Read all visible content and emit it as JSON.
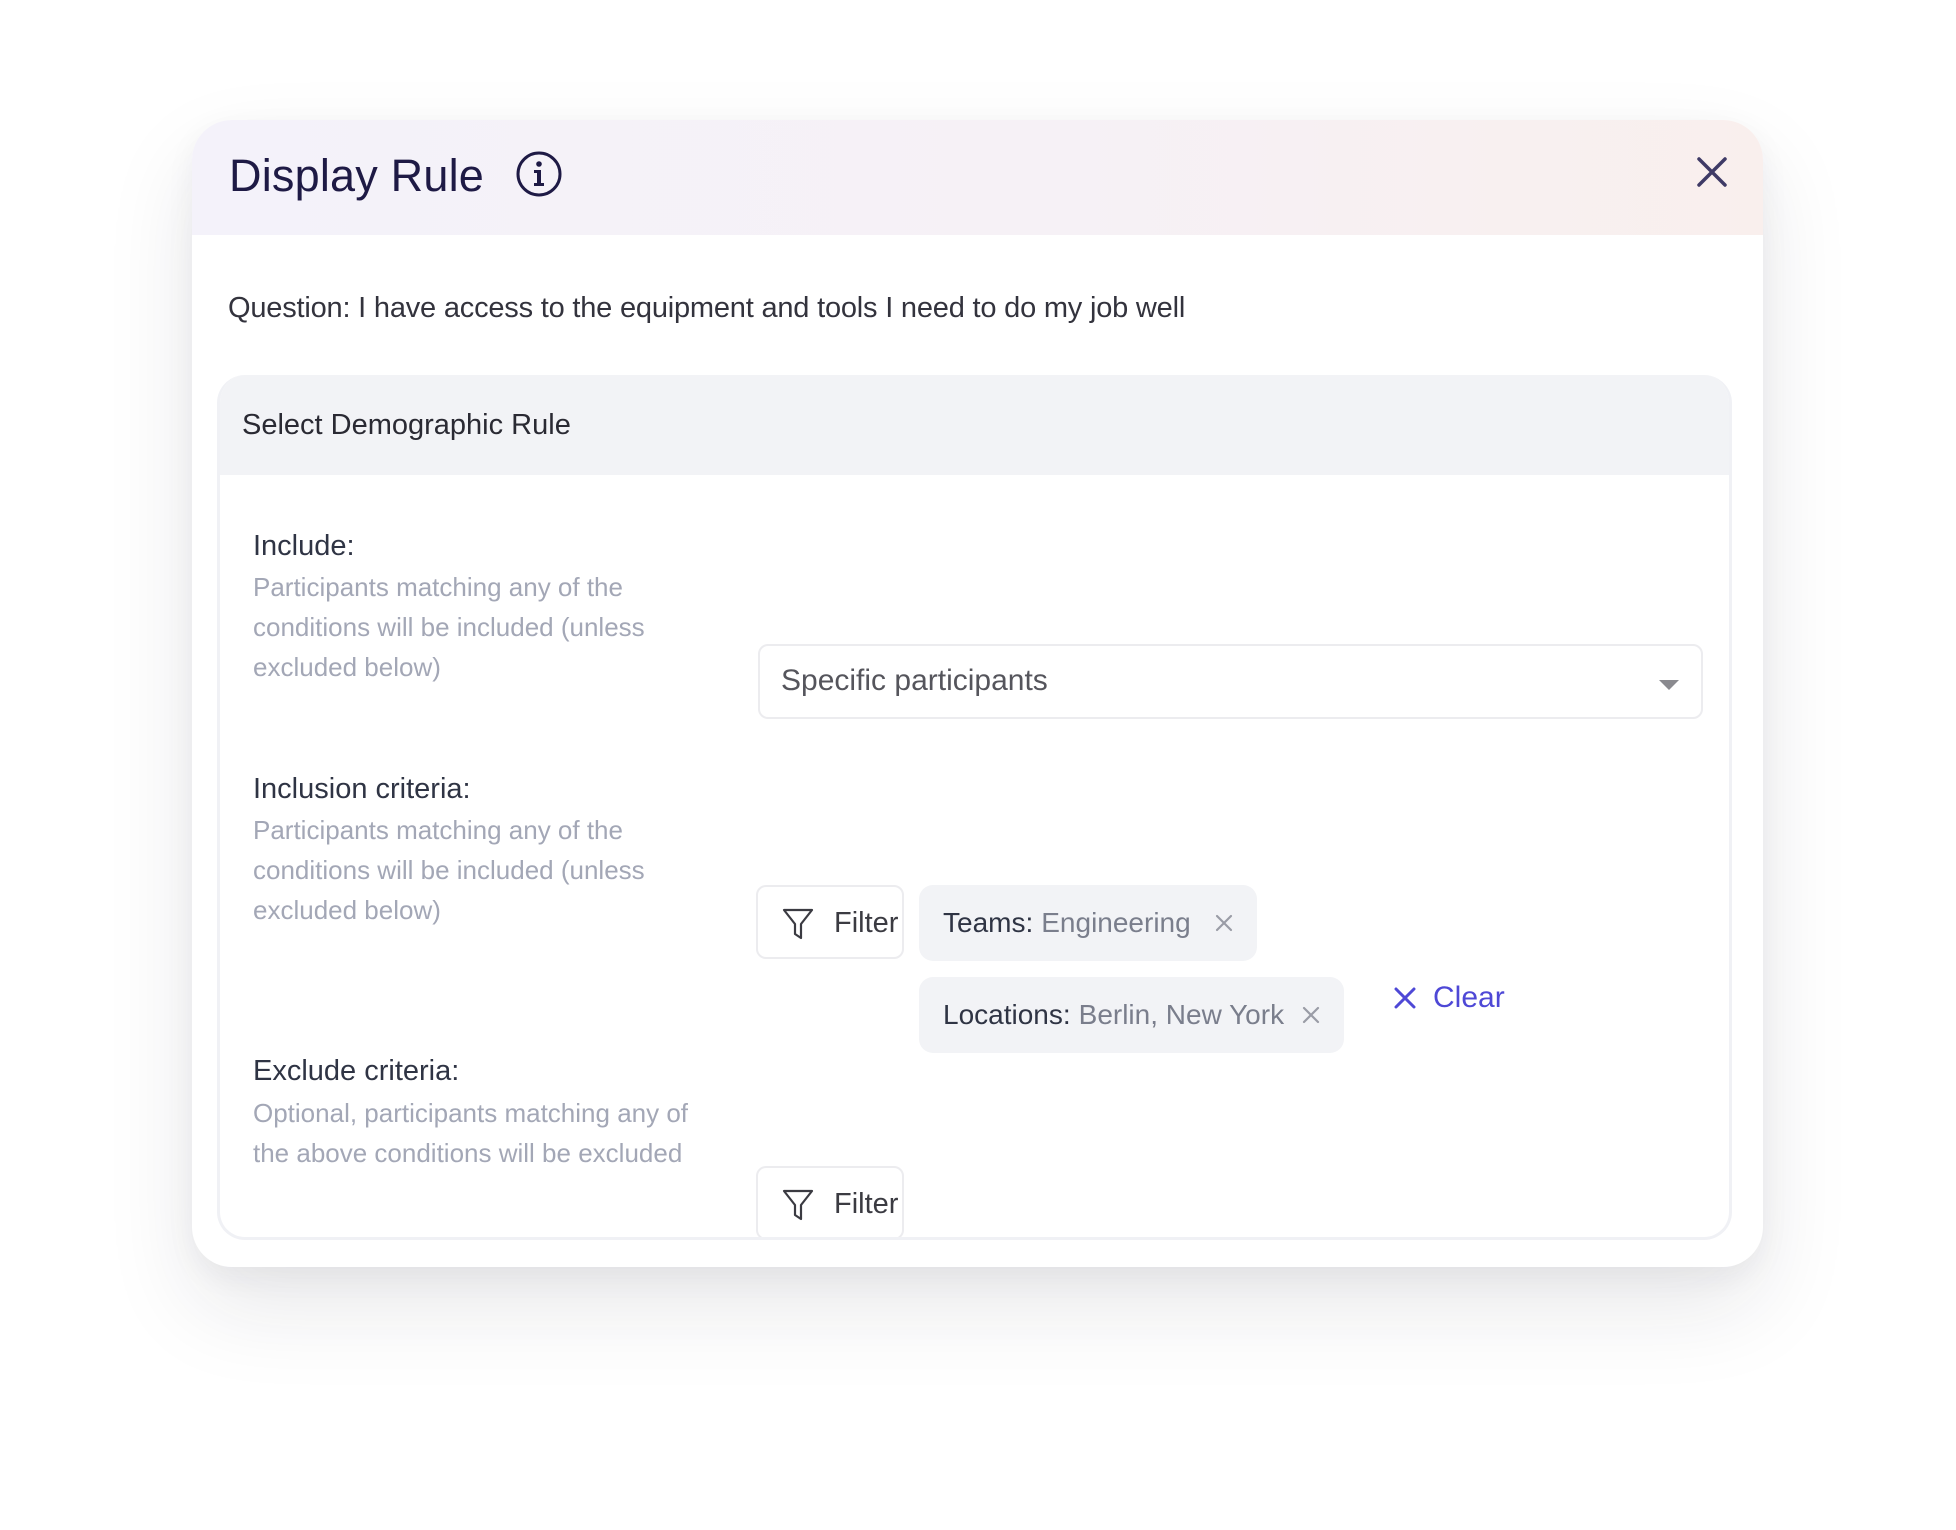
{
  "dialog": {
    "title": "Display Rule",
    "info_icon": "info-icon",
    "close_icon": "close-icon",
    "question": "Question: I have access to the equipment and tools I need to do my job well"
  },
  "panel": {
    "title": "Select Demographic Rule",
    "include": {
      "label": "Include:",
      "description": "Participants matching any of the conditions will be included (unless excluded below)",
      "select_value": "Specific participants"
    },
    "inclusion": {
      "label": "Inclusion criteria:",
      "description": "Participants matching any of the conditions will be included (unless excluded below)",
      "filter_label": "Filter",
      "chips": [
        {
          "key": "Teams:",
          "value": "Engineering"
        },
        {
          "key": "Locations:",
          "value": "Berlin, New York"
        }
      ],
      "clear_label": "Clear"
    },
    "exclude": {
      "label": "Exclude criteria:",
      "description": "Optional, participants matching any of the above conditions will be excluded",
      "filter_label": "Filter"
    }
  },
  "colors": {
    "accent": "#4e48d6",
    "title": "#1e1a45",
    "muted": "#a3a7b6",
    "chip_bg": "#f2f3f6"
  }
}
